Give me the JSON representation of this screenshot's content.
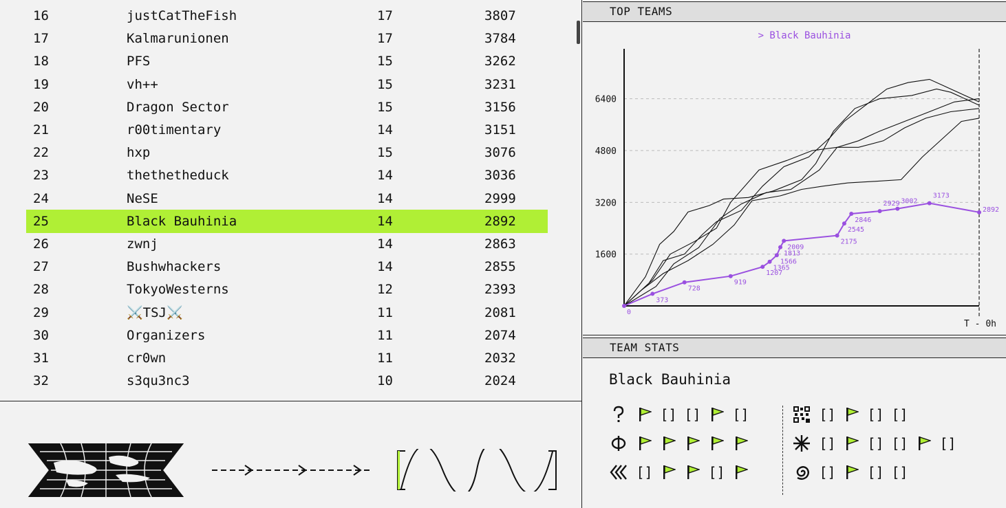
{
  "scoreboard": {
    "rows": [
      {
        "rank": "16",
        "name": "justCatTheFish",
        "solves": "17",
        "score": "3807",
        "highlighted": false
      },
      {
        "rank": "17",
        "name": "Kalmarunionen",
        "solves": "17",
        "score": "3784",
        "highlighted": false
      },
      {
        "rank": "18",
        "name": "PFS",
        "solves": "15",
        "score": "3262",
        "highlighted": false
      },
      {
        "rank": "19",
        "name": "vh++",
        "solves": "15",
        "score": "3231",
        "highlighted": false
      },
      {
        "rank": "20",
        "name": "Dragon Sector",
        "solves": "15",
        "score": "3156",
        "highlighted": false
      },
      {
        "rank": "21",
        "name": "r00timentary",
        "solves": "14",
        "score": "3151",
        "highlighted": false
      },
      {
        "rank": "22",
        "name": "hxp",
        "solves": "15",
        "score": "3076",
        "highlighted": false
      },
      {
        "rank": "23",
        "name": "thethetheduck",
        "solves": "14",
        "score": "3036",
        "highlighted": false
      },
      {
        "rank": "24",
        "name": "NeSE",
        "solves": "14",
        "score": "2999",
        "highlighted": false
      },
      {
        "rank": "25",
        "name": "Black Bauhinia",
        "solves": "14",
        "score": "2892",
        "highlighted": true
      },
      {
        "rank": "26",
        "name": "zwnj",
        "solves": "14",
        "score": "2863",
        "highlighted": false
      },
      {
        "rank": "27",
        "name": "Bushwhackers",
        "solves": "14",
        "score": "2855",
        "highlighted": false
      },
      {
        "rank": "28",
        "name": "TokyoWesterns",
        "solves": "12",
        "score": "2393",
        "highlighted": false
      },
      {
        "rank": "29",
        "name": "⚔️TSJ⚔️",
        "solves": "11",
        "score": "2081",
        "highlighted": false
      },
      {
        "rank": "30",
        "name": "Organizers",
        "solves": "11",
        "score": "2074",
        "highlighted": false
      },
      {
        "rank": "31",
        "name": "cr0wn",
        "solves": "11",
        "score": "2032",
        "highlighted": false
      },
      {
        "rank": "32",
        "name": "s3qu3nc3",
        "solves": "10",
        "score": "2024",
        "highlighted": false
      }
    ],
    "highlight_color": "#b0ef35"
  },
  "top_teams": {
    "header": "TOP TEAMS",
    "legend": "> Black Bauhinia",
    "x_label": "T - 0h",
    "colors": {
      "highlight": "#9a50e0",
      "other": "#111111"
    }
  },
  "chart_data": {
    "type": "line",
    "title": "",
    "xlabel": "T - 0h",
    "ylabel": "",
    "y_ticks": [
      1600,
      3200,
      4800,
      6400
    ],
    "ylim": [
      0,
      7900
    ],
    "xlim": [
      0,
      100
    ],
    "grid": "horizontal dashed",
    "series": [
      {
        "name": "Black Bauhinia",
        "points": [
          [
            0,
            0
          ],
          [
            8,
            373
          ],
          [
            17,
            728
          ],
          [
            30,
            919
          ],
          [
            39,
            1207
          ],
          [
            41,
            1365
          ],
          [
            43,
            1566
          ],
          [
            44,
            1813
          ],
          [
            45,
            2009
          ],
          [
            60,
            2175
          ],
          [
            62,
            2545
          ],
          [
            64,
            2846
          ],
          [
            72,
            2929
          ],
          [
            77,
            3002
          ],
          [
            86,
            3173
          ],
          [
            100,
            2892
          ]
        ]
      },
      {
        "values_path": [
          [
            0,
            0
          ],
          [
            6,
            900
          ],
          [
            10,
            1900
          ],
          [
            14,
            2300
          ],
          [
            18,
            2900
          ],
          [
            24,
            3100
          ],
          [
            28,
            3300
          ],
          [
            35,
            3350
          ],
          [
            42,
            3550
          ],
          [
            50,
            3900
          ],
          [
            54,
            4400
          ],
          [
            59,
            5400
          ],
          [
            65,
            6100
          ],
          [
            72,
            6400
          ],
          [
            81,
            6500
          ],
          [
            88,
            6700
          ],
          [
            92,
            6600
          ],
          [
            100,
            6200
          ]
        ]
      },
      {
        "values_path": [
          [
            0,
            0
          ],
          [
            7,
            700
          ],
          [
            11,
            1400
          ],
          [
            17,
            1600
          ],
          [
            22,
            2200
          ],
          [
            26,
            2600
          ],
          [
            33,
            2950
          ],
          [
            39,
            3700
          ],
          [
            45,
            4300
          ],
          [
            52,
            4600
          ],
          [
            58,
            5200
          ],
          [
            62,
            5700
          ],
          [
            68,
            6200
          ],
          [
            74,
            6700
          ],
          [
            80,
            6900
          ],
          [
            86,
            7000
          ],
          [
            90,
            6800
          ],
          [
            100,
            6300
          ]
        ]
      },
      {
        "values_path": [
          [
            0,
            0
          ],
          [
            9,
            600
          ],
          [
            14,
            1300
          ],
          [
            21,
            1800
          ],
          [
            27,
            2700
          ],
          [
            33,
            3150
          ],
          [
            40,
            3500
          ],
          [
            47,
            3600
          ],
          [
            55,
            4200
          ],
          [
            60,
            4900
          ],
          [
            66,
            5100
          ],
          [
            72,
            5400
          ],
          [
            79,
            5700
          ],
          [
            86,
            6000
          ],
          [
            93,
            6300
          ],
          [
            100,
            6400
          ]
        ]
      },
      {
        "values_path": [
          [
            0,
            0
          ],
          [
            5,
            500
          ],
          [
            11,
            1000
          ],
          [
            18,
            1400
          ],
          [
            25,
            1900
          ],
          [
            31,
            2500
          ],
          [
            36,
            3250
          ],
          [
            44,
            3400
          ],
          [
            50,
            3600
          ],
          [
            56,
            3700
          ],
          [
            63,
            3800
          ],
          [
            71,
            3850
          ],
          [
            78,
            3900
          ],
          [
            84,
            4600
          ],
          [
            90,
            5200
          ],
          [
            95,
            5700
          ],
          [
            100,
            5800
          ]
        ]
      },
      {
        "values_path": [
          [
            0,
            0
          ],
          [
            8,
            800
          ],
          [
            13,
            1600
          ],
          [
            20,
            2000
          ],
          [
            26,
            2400
          ],
          [
            30,
            3200
          ],
          [
            38,
            4200
          ],
          [
            46,
            4500
          ],
          [
            53,
            4800
          ],
          [
            60,
            4900
          ],
          [
            66,
            4900
          ],
          [
            73,
            5100
          ],
          [
            79,
            5500
          ],
          [
            85,
            5800
          ],
          [
            92,
            6000
          ],
          [
            100,
            6100
          ]
        ]
      }
    ]
  },
  "team_stats": {
    "header": "TEAM STATS",
    "team_name": "Black Bauhinia",
    "flag_color": "#b0ef35",
    "categories_left": [
      {
        "icon": "question-icon",
        "glyph": "?",
        "statuses": [
          "flag",
          "open",
          "open",
          "flag",
          "open"
        ]
      },
      {
        "icon": "phi-icon",
        "glyph": "φ",
        "statuses": [
          "flag",
          "flag",
          "flag",
          "flag",
          "flag"
        ]
      },
      {
        "icon": "chevrons-left-icon",
        "glyph": "«",
        "statuses": [
          "open",
          "flag",
          "flag",
          "open",
          "flag"
        ]
      }
    ],
    "categories_right": [
      {
        "icon": "qr-icon",
        "glyph": "▦",
        "statuses": [
          "open",
          "flag",
          "open",
          "open"
        ]
      },
      {
        "icon": "asterisk-icon",
        "glyph": "✳",
        "statuses": [
          "open",
          "flag",
          "open",
          "open",
          "flag",
          "open"
        ]
      },
      {
        "icon": "spiral-icon",
        "glyph": "@",
        "statuses": [
          "open",
          "flag",
          "open",
          "open"
        ]
      }
    ],
    "open_label": "[]"
  },
  "footer": {
    "icons": [
      "world-map-icon",
      "arrow-dashed-icon",
      "sine-wave-icon"
    ]
  }
}
